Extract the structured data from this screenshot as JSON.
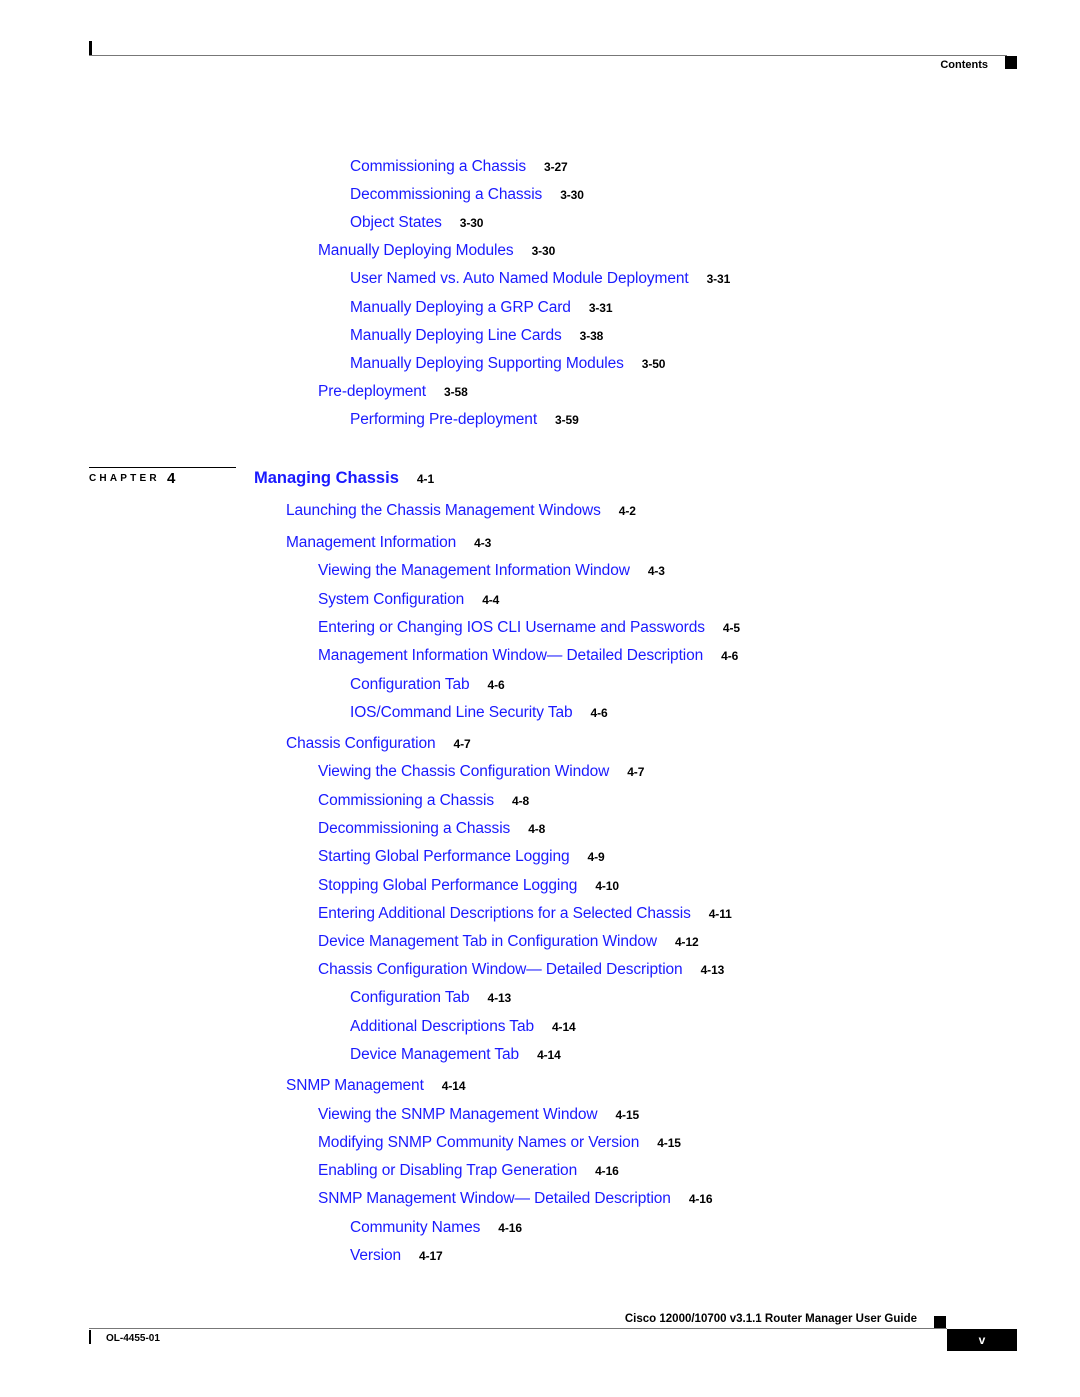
{
  "header": {
    "section_label": "Contents"
  },
  "toc_pre": [
    {
      "level": 3,
      "title": "Commissioning a Chassis",
      "page": "3-27"
    },
    {
      "level": 3,
      "title": "Decommissioning a Chassis",
      "page": "3-30"
    },
    {
      "level": 3,
      "title": "Object States",
      "page": "3-30"
    },
    {
      "level": 2,
      "title": "Manually Deploying Modules",
      "page": "3-30"
    },
    {
      "level": 3,
      "title": "User Named vs. Auto Named Module Deployment",
      "page": "3-31"
    },
    {
      "level": 3,
      "title": "Manually Deploying a GRP Card",
      "page": "3-31"
    },
    {
      "level": 3,
      "title": "Manually Deploying Line Cards",
      "page": "3-38"
    },
    {
      "level": 3,
      "title": "Manually Deploying Supporting Modules",
      "page": "3-50"
    },
    {
      "level": 2,
      "title": "Pre-deployment",
      "page": "3-58"
    },
    {
      "level": 3,
      "title": "Performing Pre-deployment",
      "page": "3-59"
    }
  ],
  "chapter": {
    "label": "CHAPTER",
    "number": "4",
    "title": "Managing Chassis",
    "page": "4-1"
  },
  "toc_chapter": [
    {
      "level": 1,
      "title": "Launching the Chassis Management Windows",
      "page": "4-2"
    },
    {
      "level": 1,
      "title": "Management Information",
      "page": "4-3"
    },
    {
      "level": 2,
      "title": "Viewing the Management Information Window",
      "page": "4-3"
    },
    {
      "level": 2,
      "title": "System Configuration",
      "page": "4-4"
    },
    {
      "level": 2,
      "title": "Entering or Changing IOS CLI Username and Passwords",
      "page": "4-5"
    },
    {
      "level": 2,
      "title": "Management Information Window— Detailed Description",
      "page": "4-6"
    },
    {
      "level": 3,
      "title": "Configuration Tab",
      "page": "4-6"
    },
    {
      "level": 3,
      "title": "IOS/Command Line Security Tab",
      "page": "4-6"
    },
    {
      "level": 1,
      "title": "Chassis Configuration",
      "page": "4-7"
    },
    {
      "level": 2,
      "title": "Viewing the Chassis Configuration Window",
      "page": "4-7"
    },
    {
      "level": 2,
      "title": "Commissioning a Chassis",
      "page": "4-8"
    },
    {
      "level": 2,
      "title": "Decommissioning a Chassis",
      "page": "4-8"
    },
    {
      "level": 2,
      "title": "Starting Global Performance Logging",
      "page": "4-9"
    },
    {
      "level": 2,
      "title": "Stopping Global Performance Logging",
      "page": "4-10"
    },
    {
      "level": 2,
      "title": "Entering Additional Descriptions for a Selected Chassis",
      "page": "4-11"
    },
    {
      "level": 2,
      "title": "Device Management Tab in Configuration Window",
      "page": "4-12"
    },
    {
      "level": 2,
      "title": "Chassis Configuration Window— Detailed Description",
      "page": "4-13"
    },
    {
      "level": 3,
      "title": "Configuration Tab",
      "page": "4-13"
    },
    {
      "level": 3,
      "title": "Additional Descriptions Tab",
      "page": "4-14"
    },
    {
      "level": 3,
      "title": "Device Management Tab",
      "page": "4-14"
    },
    {
      "level": 1,
      "title": "SNMP Management",
      "page": "4-14"
    },
    {
      "level": 2,
      "title": "Viewing the SNMP Management Window",
      "page": "4-15"
    },
    {
      "level": 2,
      "title": "Modifying SNMP Community Names or Version",
      "page": "4-15"
    },
    {
      "level": 2,
      "title": "Enabling or Disabling Trap Generation",
      "page": "4-16"
    },
    {
      "level": 2,
      "title": "SNMP Management Window— Detailed Description",
      "page": "4-16"
    },
    {
      "level": 3,
      "title": "Community Names",
      "page": "4-16"
    },
    {
      "level": 3,
      "title": "Version",
      "page": "4-17"
    }
  ],
  "footer": {
    "guide_title": "Cisco 12000/10700 v3.1.1 Router Manager User Guide",
    "doc_number": "OL-4455-01",
    "page_number": "v"
  }
}
